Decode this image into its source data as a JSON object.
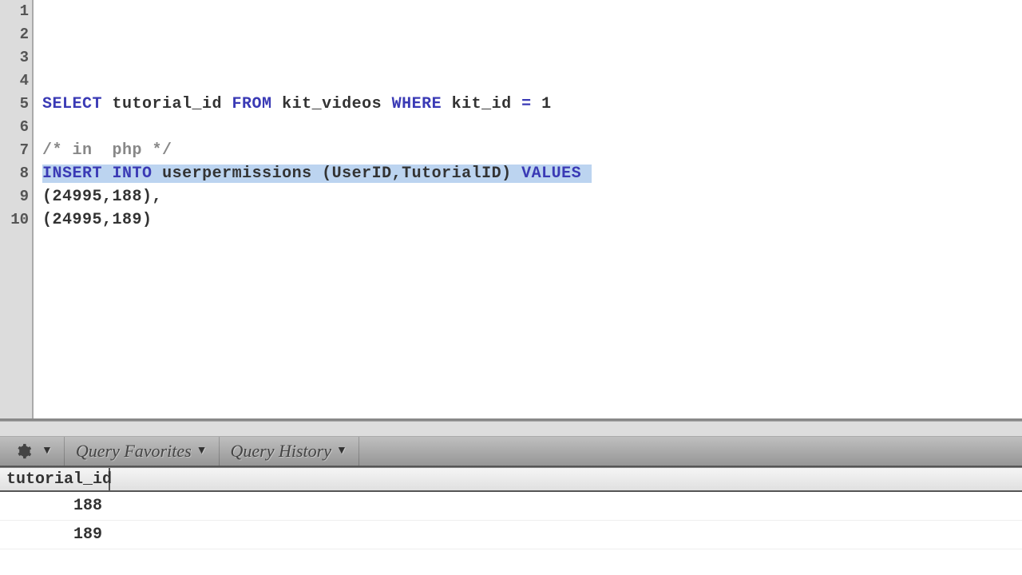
{
  "editor": {
    "line_numbers": [
      "1",
      "2",
      "3",
      "4",
      "5",
      "6",
      "7",
      "8",
      "9",
      "10"
    ],
    "line5": {
      "k1": "SELECT",
      "id1": " tutorial_id ",
      "k2": "FROM",
      "id2": " kit_videos ",
      "k3": "WHERE",
      "id3": " kit_id ",
      "op": "=",
      "val": " 1"
    },
    "line7": "/* in  php */",
    "line8": {
      "k1": "INSERT",
      "sp1": " ",
      "k2": "INTO",
      "sp2": " ",
      "tbl": "userpermissions",
      "paren": " (UserID,TutorialID) ",
      "k3": "VALUES",
      "tail": " "
    },
    "line9": "(24995,188),",
    "line10": "(24995,189)"
  },
  "tabs": {
    "favorites": "Query Favorites",
    "history": "Query History"
  },
  "results": {
    "column": "tutorial_id",
    "rows": [
      "188",
      "189"
    ]
  }
}
